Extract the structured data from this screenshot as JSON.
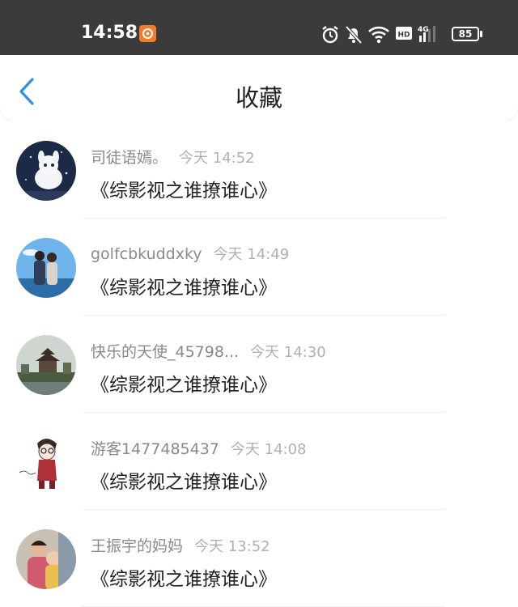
{
  "status_bar": {
    "time": "14:58",
    "battery": "85",
    "icons": [
      "alarm-icon",
      "mute-icon",
      "wifi-icon",
      "hd-icon",
      "4g-signal-icon",
      "battery-icon"
    ]
  },
  "header": {
    "title": "收藏",
    "back_icon": "chevron-left-icon",
    "accent_color": "#2f8ee5"
  },
  "favorites": [
    {
      "username": "司徒语嫣。",
      "time": "今天 14:52",
      "title": "《综影视之谁撩谁心》",
      "avatar": "white-rabbit-night"
    },
    {
      "username": "golfcbkuddxky",
      "time": "今天 14:49",
      "title": "《综影视之谁撩谁心》",
      "avatar": "couple-sky"
    },
    {
      "username": "快乐的天使_45798...",
      "time": "今天 14:30",
      "title": "《综影视之谁撩谁心》",
      "avatar": "pagoda-landscape"
    },
    {
      "username": "游客1477485437",
      "time": "今天 14:08",
      "title": "《综影视之谁撩谁心》",
      "avatar": "cartoon-boy-sketch"
    },
    {
      "username": "王振宇的妈妈",
      "time": "今天 13:52",
      "title": "《综影视之谁撩谁心》",
      "avatar": "mother-child-photo"
    }
  ]
}
